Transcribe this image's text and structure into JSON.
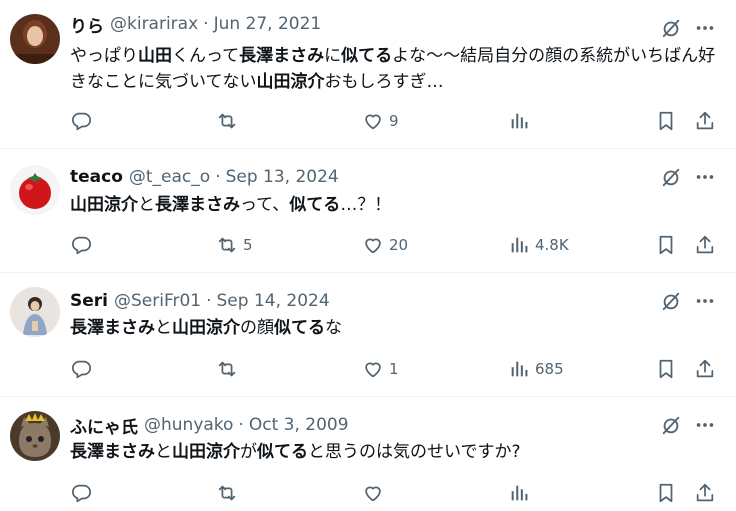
{
  "tweets": [
    {
      "name": "りら",
      "handle": "@kirarirax",
      "date": "Jun 27, 2021",
      "body": [
        {
          "t": "やっぱり",
          "b": false
        },
        {
          "t": "山田",
          "b": true
        },
        {
          "t": "くんって",
          "b": false
        },
        {
          "t": "長澤まさみ",
          "b": true
        },
        {
          "t": "に",
          "b": false
        },
        {
          "t": "似てる",
          "b": true
        },
        {
          "t": "よな〜〜結局自分の顔の系統がいちばん好きなことに気づいてない",
          "b": false
        },
        {
          "t": "山田涼介",
          "b": true
        },
        {
          "t": "おもしろすぎ…",
          "b": false
        }
      ],
      "replies": "",
      "retweets": "",
      "likes": "9",
      "views": ""
    },
    {
      "name": "teaco",
      "handle": "@t_eac_o",
      "date": "Sep 13, 2024",
      "body": [
        {
          "t": "山田涼介",
          "b": true
        },
        {
          "t": "と",
          "b": false
        },
        {
          "t": "長澤まさみ",
          "b": true
        },
        {
          "t": "って、",
          "b": false
        },
        {
          "t": "似てる",
          "b": true
        },
        {
          "t": "…？！",
          "b": false
        }
      ],
      "replies": "",
      "retweets": "5",
      "likes": "20",
      "views": "4.8K"
    },
    {
      "name": "Seri",
      "handle": "@SeriFr01",
      "date": "Sep 14, 2024",
      "body": [
        {
          "t": "長澤まさみ",
          "b": true
        },
        {
          "t": "と",
          "b": false
        },
        {
          "t": "山田涼介",
          "b": true
        },
        {
          "t": "の顔",
          "b": false
        },
        {
          "t": "似てる",
          "b": true
        },
        {
          "t": "な",
          "b": false
        }
      ],
      "replies": "",
      "retweets": "",
      "likes": "1",
      "views": "685"
    },
    {
      "name": "ふにゃ氏",
      "handle": "@hunyako",
      "date": "Oct 3, 2009",
      "body": [
        {
          "t": "長澤まさみ",
          "b": true
        },
        {
          "t": "と",
          "b": false
        },
        {
          "t": "山田涼介",
          "b": true
        },
        {
          "t": "が",
          "b": false
        },
        {
          "t": "似てる",
          "b": true
        },
        {
          "t": "と思うのは気のせいですか?",
          "b": false
        }
      ],
      "replies": "",
      "retweets": "",
      "likes": "",
      "views": ""
    }
  ],
  "icons": {
    "grok": "grok-icon",
    "more": "more-icon",
    "reply": "reply-icon",
    "retweet": "retweet-icon",
    "like": "heart-icon",
    "views": "views-icon",
    "bookmark": "bookmark-icon",
    "share": "share-icon"
  },
  "colors": {
    "text": "#0f1419",
    "secondary": "#536471",
    "divider": "#eff3f4"
  }
}
